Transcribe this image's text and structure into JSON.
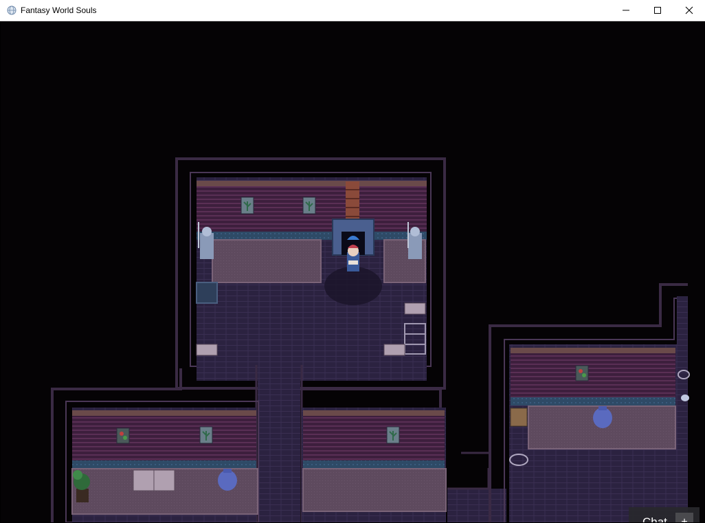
{
  "window": {
    "title": "Fantasy World Souls",
    "controls": {
      "minimize_icon": "minimize-icon",
      "maximize_icon": "maximize-icon",
      "close_icon": "close-icon"
    }
  },
  "game": {
    "scene": "indoor mansion map viewed from above",
    "colors": {
      "void": "#050305",
      "wall_outline": "#3a2a44",
      "back_wall": "#3d1f3d",
      "wall_stripe": "#5a2f55",
      "floor": "#2b2240",
      "floor_line": "#3a2f52",
      "carpet": "#5e4a5e",
      "baseboard": "#2e4a66"
    }
  },
  "chat": {
    "label": "Chat",
    "plus": "+"
  }
}
